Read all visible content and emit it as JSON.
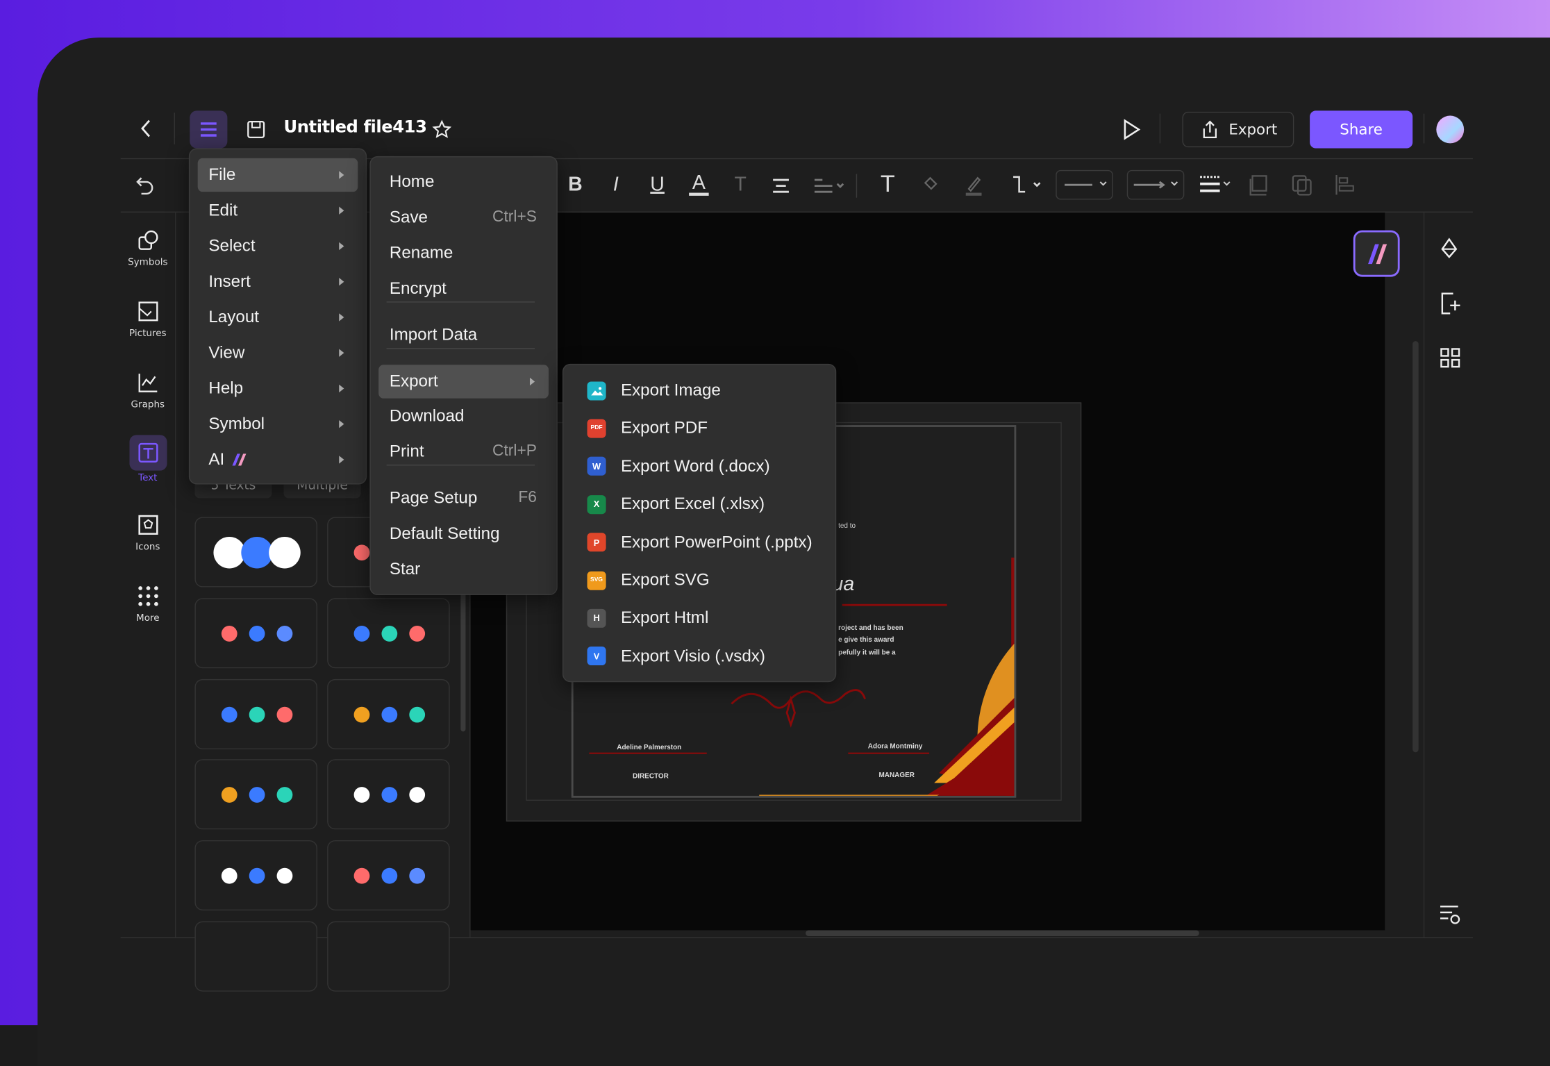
{
  "header": {
    "title": "Untitled file413",
    "export_label": "Export",
    "share_label": "Share"
  },
  "colors": {
    "accent": "#7b57ff",
    "menu_bg": "#2f2f2f",
    "highlight": "#505050",
    "canvas": "#080808"
  },
  "rail": [
    {
      "label": "Symbols",
      "icon": "symbols-icon"
    },
    {
      "label": "Pictures",
      "icon": "picture-icon"
    },
    {
      "label": "Graphs",
      "icon": "graph-icon"
    },
    {
      "label": "Text",
      "icon": "text-icon",
      "active": true
    },
    {
      "label": "Icons",
      "icon": "icons-icon"
    },
    {
      "label": "More",
      "icon": "more-icon"
    }
  ],
  "panel": {
    "chips": [
      "5 Texts",
      "Multiple"
    ]
  },
  "main_menu": [
    {
      "label": "File",
      "active": true
    },
    {
      "label": "Edit"
    },
    {
      "label": "Select"
    },
    {
      "label": "Insert"
    },
    {
      "label": "Layout"
    },
    {
      "label": "View"
    },
    {
      "label": "Help"
    },
    {
      "label": "Symbol"
    },
    {
      "label": "AI"
    }
  ],
  "file_menu": [
    {
      "label": "Home"
    },
    {
      "label": "Save",
      "shortcut": "Ctrl+S"
    },
    {
      "label": "Rename"
    },
    {
      "label": "Encrypt"
    },
    {
      "label": "Import Data"
    },
    {
      "label": "Export",
      "active": true
    },
    {
      "label": "Download"
    },
    {
      "label": "Print",
      "shortcut": "Ctrl+P"
    },
    {
      "label": "Page Setup",
      "shortcut": "F6"
    },
    {
      "label": "Default Setting"
    },
    {
      "label": "Star"
    }
  ],
  "export_menu": [
    {
      "label": "Export Image",
      "badge": "",
      "color": "#1fb6c9"
    },
    {
      "label": "Export PDF",
      "badge": "PDF",
      "color": "#e0412f"
    },
    {
      "label": "Export Word (.docx)",
      "badge": "W",
      "color": "#2f5fd0"
    },
    {
      "label": "Export Excel (.xlsx)",
      "badge": "X",
      "color": "#17894a"
    },
    {
      "label": "Export PowerPoint (.pptx)",
      "badge": "P",
      "color": "#e0462a"
    },
    {
      "label": "Export SVG",
      "badge": "SVG",
      "color": "#f09a1c"
    },
    {
      "label": "Export Html",
      "badge": "H",
      "color": "#555555"
    },
    {
      "label": "Export Visio (.vsdx)",
      "badge": "V",
      "color": "#2f76f0"
    }
  ],
  "certificate": {
    "presented": "ted to",
    "name_fragment": "ua",
    "body": [
      "roject and has been",
      "e give this award",
      "pefully it will be a"
    ],
    "sign1": "Adeline Palmerston",
    "role1": "DIRECTOR",
    "sign2": "Adora Montminy",
    "role2": "MANAGER"
  }
}
